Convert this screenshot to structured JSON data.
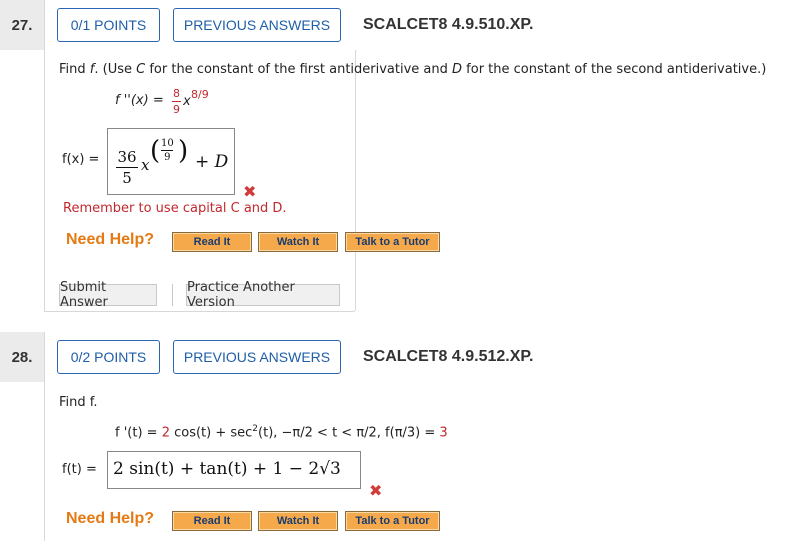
{
  "q27": {
    "number": "27.",
    "points": "0/1 POINTS",
    "previous": "PREVIOUS ANSWERS",
    "code": "SCALCET8 4.9.510.XP.",
    "instr_a": "Find ",
    "instr_f": "f",
    "instr_b": ". (Use ",
    "instr_c": "C",
    "instr_d": " for the constant of the first antiderivative and ",
    "instr_e": "D",
    "instr_g": " for the constant of the second antiderivative.)",
    "given_lhs": "f ''(x) = ",
    "given_coef_num": "8",
    "given_coef_den": "9",
    "given_x": "x",
    "given_exp": "8/9",
    "answer_label": "f(x) = ",
    "ans_coef_num": "36",
    "ans_coef_den": "5",
    "ans_x": "x",
    "ans_exp_num": "10",
    "ans_exp_den": "9",
    "ans_tail": "+ D",
    "feedback": "Remember to use capital C and D.",
    "need_help": "Need Help?",
    "read_it": "Read It",
    "watch_it": "Watch It",
    "talk_tutor": "Talk to a Tutor",
    "submit": "Submit Answer",
    "practice": "Practice Another Version"
  },
  "q28": {
    "number": "28.",
    "points": "0/2 POINTS",
    "previous": "PREVIOUS ANSWERS",
    "code": "SCALCET8 4.9.512.XP.",
    "instr": "Find f.",
    "eq_lhs": "f '(t) = ",
    "eq_coef": "2",
    "eq_rest": " cos(t) + sec",
    "eq_sq": "2",
    "eq_rest2": "(t),    −π/2 < t < π/2,   f(π/3) = ",
    "eq_val": "3",
    "answer_label": "f(t) = ",
    "answer_value": "2 sin(t) + tan(t) + 1 − 2√3",
    "need_help": "Need Help?",
    "read_it": "Read It",
    "watch_it": "Watch It",
    "talk_tutor": "Talk to a Tutor"
  },
  "colors": {
    "accent_blue": "#1f5ea8",
    "error_red": "#c2282e",
    "help_orange": "#e57a14",
    "button_orange": "#f5a94a"
  },
  "icons": {
    "wrong": "x-mark-icon"
  }
}
